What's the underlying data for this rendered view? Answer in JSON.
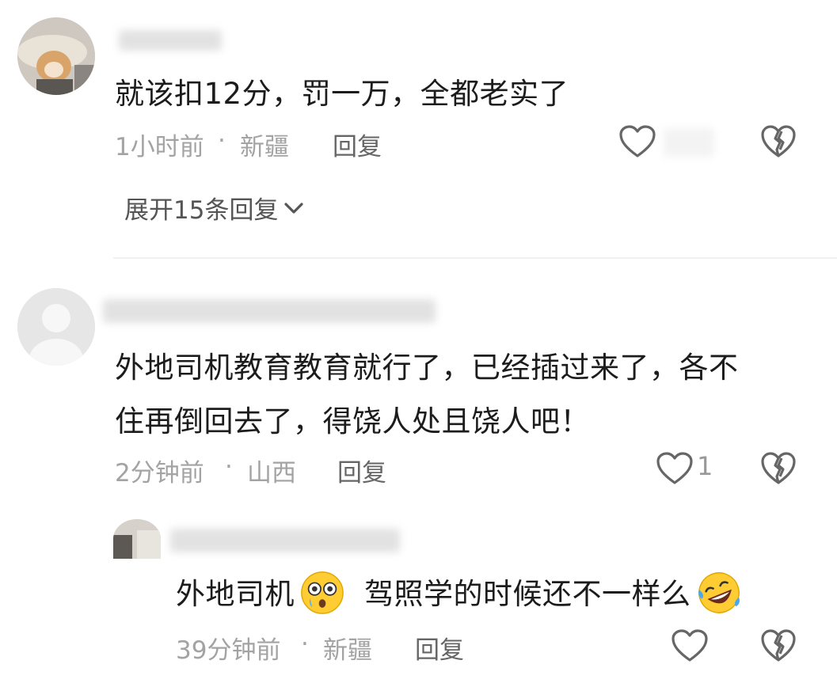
{
  "comments": [
    {
      "text": "就该扣12分，罚一万，全都老实了",
      "time": "1小时前",
      "sep": "·",
      "location": "新疆",
      "reply_label": "回复",
      "like_count": "",
      "expand_label": "展开15条回复"
    },
    {
      "text_line1": "外地司机教育教育就行了，已经插过来了，各不",
      "text_line2": "住再倒回去了，得饶人处且饶人吧！",
      "time": "2分钟前",
      "sep": "·",
      "location": "山西",
      "reply_label": "回复",
      "like_count": "1"
    },
    {
      "text_part1": "外地司机",
      "text_part2": "驾照学的时候还不一样么",
      "time": "39分钟前",
      "sep": "·",
      "location": "新疆",
      "reply_label": "回复",
      "emoji1": "flushed-face-emoji",
      "emoji2": "rolling-laughing-emoji"
    }
  ],
  "icons": {
    "like": "heart-outline-icon",
    "dislike": "broken-heart-icon",
    "expand": "chevron-down-icon"
  },
  "colors": {
    "text": "#1c1c1c",
    "meta": "#a3a3a3",
    "icon": "#666666"
  }
}
